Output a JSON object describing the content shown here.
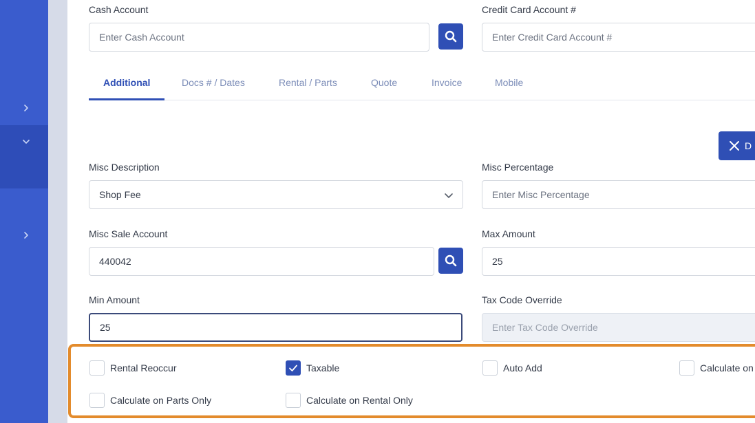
{
  "fields": {
    "cash_account": {
      "label": "Cash Account",
      "placeholder": "Enter Cash Account"
    },
    "credit_card_account": {
      "label": "Credit Card Account #",
      "placeholder": "Enter Credit Card Account #"
    },
    "misc_description": {
      "label": "Misc Description",
      "value": "Shop Fee"
    },
    "misc_percentage": {
      "label": "Misc Percentage",
      "placeholder": "Enter Misc Percentage"
    },
    "misc_sale_account": {
      "label": "Misc Sale Account",
      "value": "440042"
    },
    "max_amount": {
      "label": "Max Amount",
      "value": "25"
    },
    "min_amount": {
      "label": "Min Amount",
      "value": "25"
    },
    "tax_code_override": {
      "label": "Tax Code Override",
      "placeholder": "Enter Tax Code Override"
    }
  },
  "tabs": [
    {
      "label": "Additional",
      "active": true
    },
    {
      "label": "Docs # / Dates"
    },
    {
      "label": "Rental / Parts"
    },
    {
      "label": "Quote"
    },
    {
      "label": "Invoice"
    },
    {
      "label": "Mobile"
    }
  ],
  "delete_button": {
    "label": "D"
  },
  "checkboxes": [
    {
      "label": "Rental Reoccur",
      "checked": false
    },
    {
      "label": "Taxable",
      "checked": true
    },
    {
      "label": "Auto Add",
      "checked": false
    },
    {
      "label": "Calculate on",
      "checked": false
    },
    {
      "label": "Calculate on Parts Only",
      "checked": false
    },
    {
      "label": "Calculate on Rental Only",
      "checked": false
    }
  ],
  "icons": {
    "search": "search-icon",
    "close": "close-icon",
    "chevron_down": "chevron-down-icon",
    "chevron_right": "chevron-right-icon",
    "check": "check-icon"
  },
  "colors": {
    "sidebar": "#3a5ccd",
    "primary": "#2f4fb5",
    "highlight_border": "#e38b2c"
  }
}
